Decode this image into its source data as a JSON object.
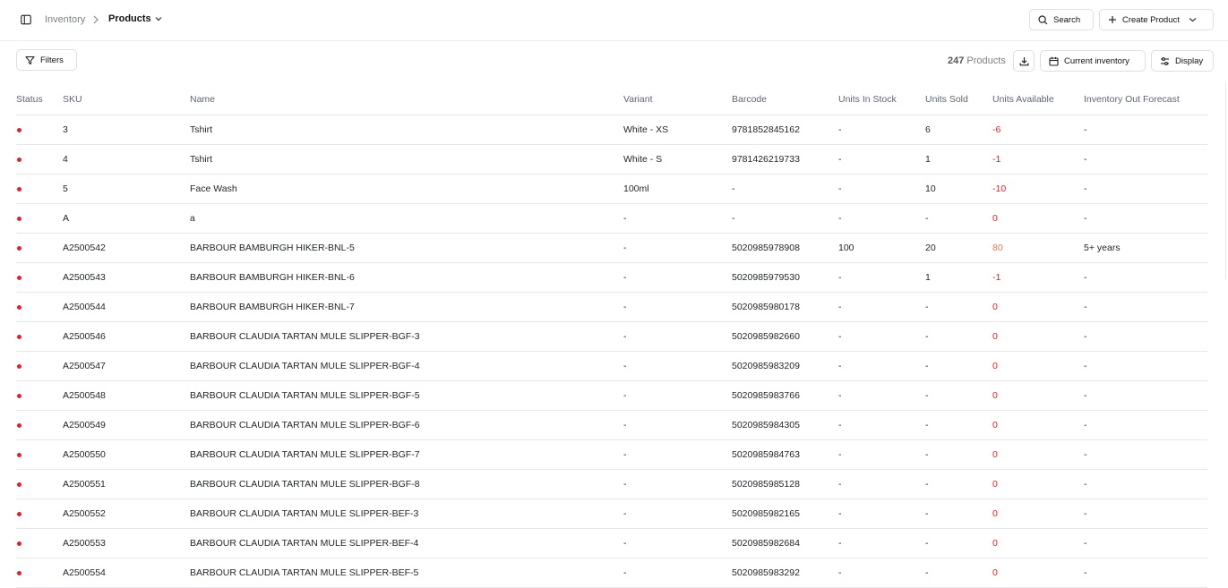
{
  "breadcrumb": {
    "parent": "Inventory",
    "current": "Products"
  },
  "toolbar": {
    "search_label": "Search",
    "create_label": "Create Product",
    "filters_label": "Filters",
    "count_number": "247",
    "count_suffix": "Products",
    "inventory_label": "Current inventory",
    "display_label": "Display"
  },
  "colors": {
    "status_red": "#e5202b",
    "negative": "#e5202b",
    "positive": "#e0775a"
  },
  "table": {
    "columns": [
      "Status",
      "SKU",
      "Name",
      "Variant",
      "Barcode",
      "Units In Stock",
      "Units Sold",
      "Units Available",
      "Inventory Out Forecast"
    ],
    "rows": [
      {
        "sku": "3",
        "name": "Tshirt",
        "variant": "White - XS",
        "barcode": "9781852845162",
        "in_stock": "-",
        "sold": "6",
        "available": "-6",
        "forecast": "-"
      },
      {
        "sku": "4",
        "name": "Tshirt",
        "variant": "White - S",
        "barcode": "9781426219733",
        "in_stock": "-",
        "sold": "1",
        "available": "-1",
        "forecast": "-"
      },
      {
        "sku": "5",
        "name": "Face Wash",
        "variant": "100ml",
        "barcode": "-",
        "in_stock": "-",
        "sold": "10",
        "available": "-10",
        "forecast": "-"
      },
      {
        "sku": "A",
        "name": "a",
        "variant": "-",
        "barcode": "-",
        "in_stock": "-",
        "sold": "-",
        "available": "0",
        "forecast": "-"
      },
      {
        "sku": "A2500542",
        "name": "BARBOUR BAMBURGH HIKER-BNL-5",
        "variant": "-",
        "barcode": "5020985978908",
        "in_stock": "100",
        "sold": "20",
        "available": "80",
        "forecast": "5+ years"
      },
      {
        "sku": "A2500543",
        "name": "BARBOUR BAMBURGH HIKER-BNL-6",
        "variant": "-",
        "barcode": "5020985979530",
        "in_stock": "-",
        "sold": "1",
        "available": "-1",
        "forecast": "-"
      },
      {
        "sku": "A2500544",
        "name": "BARBOUR BAMBURGH HIKER-BNL-7",
        "variant": "-",
        "barcode": "5020985980178",
        "in_stock": "-",
        "sold": "-",
        "available": "0",
        "forecast": "-"
      },
      {
        "sku": "A2500546",
        "name": "BARBOUR CLAUDIA TARTAN MULE SLIPPER-BGF-3",
        "variant": "-",
        "barcode": "5020985982660",
        "in_stock": "-",
        "sold": "-",
        "available": "0",
        "forecast": "-"
      },
      {
        "sku": "A2500547",
        "name": "BARBOUR CLAUDIA TARTAN MULE SLIPPER-BGF-4",
        "variant": "-",
        "barcode": "5020985983209",
        "in_stock": "-",
        "sold": "-",
        "available": "0",
        "forecast": "-"
      },
      {
        "sku": "A2500548",
        "name": "BARBOUR CLAUDIA TARTAN MULE SLIPPER-BGF-5",
        "variant": "-",
        "barcode": "5020985983766",
        "in_stock": "-",
        "sold": "-",
        "available": "0",
        "forecast": "-"
      },
      {
        "sku": "A2500549",
        "name": "BARBOUR CLAUDIA TARTAN MULE SLIPPER-BGF-6",
        "variant": "-",
        "barcode": "5020985984305",
        "in_stock": "-",
        "sold": "-",
        "available": "0",
        "forecast": "-"
      },
      {
        "sku": "A2500550",
        "name": "BARBOUR CLAUDIA TARTAN MULE SLIPPER-BGF-7",
        "variant": "-",
        "barcode": "5020985984763",
        "in_stock": "-",
        "sold": "-",
        "available": "0",
        "forecast": "-"
      },
      {
        "sku": "A2500551",
        "name": "BARBOUR CLAUDIA TARTAN MULE SLIPPER-BGF-8",
        "variant": "-",
        "barcode": "5020985985128",
        "in_stock": "-",
        "sold": "-",
        "available": "0",
        "forecast": "-"
      },
      {
        "sku": "A2500552",
        "name": "BARBOUR CLAUDIA TARTAN MULE SLIPPER-BEF-3",
        "variant": "-",
        "barcode": "5020985982165",
        "in_stock": "-",
        "sold": "-",
        "available": "0",
        "forecast": "-"
      },
      {
        "sku": "A2500553",
        "name": "BARBOUR CLAUDIA TARTAN MULE SLIPPER-BEF-4",
        "variant": "-",
        "barcode": "5020985982684",
        "in_stock": "-",
        "sold": "-",
        "available": "0",
        "forecast": "-"
      },
      {
        "sku": "A2500554",
        "name": "BARBOUR CLAUDIA TARTAN MULE SLIPPER-BEF-5",
        "variant": "-",
        "barcode": "5020985983292",
        "in_stock": "-",
        "sold": "-",
        "available": "0",
        "forecast": "-"
      }
    ]
  }
}
